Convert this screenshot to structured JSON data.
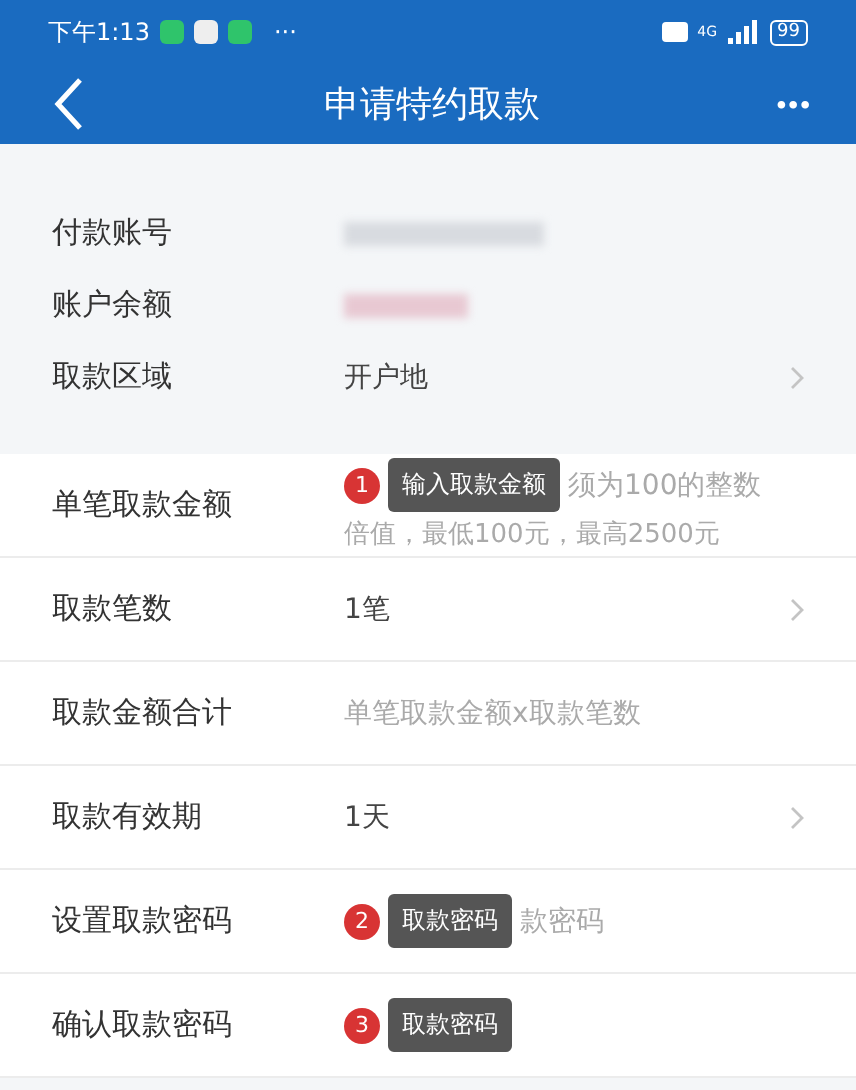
{
  "status_bar": {
    "time": "下午1:13",
    "more": "···",
    "network": "4G",
    "battery": "99"
  },
  "nav": {
    "title": "申请特约取款",
    "more": "•••"
  },
  "account": [
    {
      "label": "付款账号",
      "kind": "masked"
    },
    {
      "label": "账户余额",
      "kind": "masked"
    },
    {
      "label": "取款区域",
      "kind": "choice",
      "value": "开户地"
    }
  ],
  "form": [
    {
      "label": "单笔取款金额",
      "kind": "hint",
      "badge": "1",
      "tooltip": "输入取款金额",
      "hint": "须为100的整数",
      "hint_line2": "倍值，最低100元，最高2500元"
    },
    {
      "label": "取款笔数",
      "kind": "choice",
      "value": "1笔"
    },
    {
      "label": "取款金额合计",
      "kind": "hint",
      "hint": "单笔取款金额x取款笔数"
    },
    {
      "label": "取款有效期",
      "kind": "choice",
      "value": "1天"
    },
    {
      "label": "设置取款密码",
      "kind": "hint",
      "badge": "2",
      "tooltip": "取款密码",
      "hint": "款密码"
    },
    {
      "label": "确认取款密码",
      "kind": "hint",
      "badge": "3",
      "tooltip": "取款密码"
    }
  ]
}
